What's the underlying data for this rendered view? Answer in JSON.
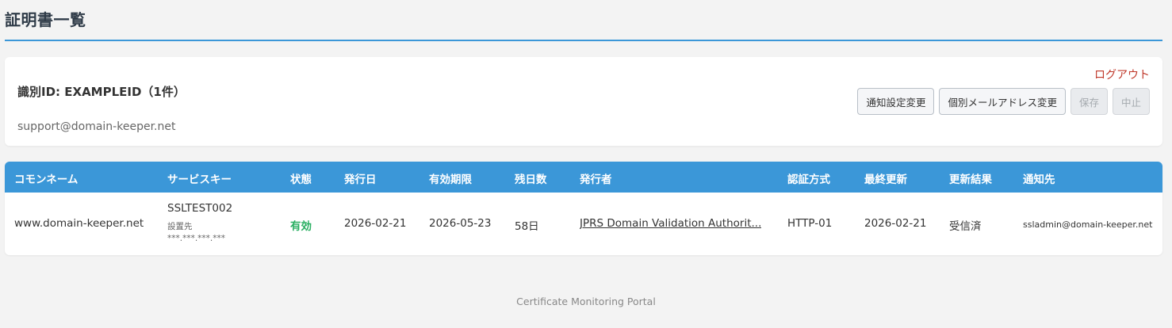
{
  "page": {
    "title": "証明書一覧"
  },
  "account": {
    "id_label": "識別ID: EXAMPLEID（1件）",
    "email": "support@domain-keeper.net"
  },
  "header_actions": {
    "logout": "ログアウト",
    "buttons": {
      "notify_settings": "通知設定変更",
      "mail_change": "個別メールアドレス変更",
      "save": "保存",
      "cancel": "中止"
    }
  },
  "table": {
    "columns": {
      "common_name": "コモンネーム",
      "service_key": "サービスキー",
      "status": "状態",
      "issued": "発行日",
      "expiry": "有効期限",
      "days_left": "残日数",
      "issuer": "発行者",
      "auth_method": "認証方式",
      "last_update": "最終更新",
      "update_result": "更新結果",
      "notify_to": "通知先"
    },
    "rows": [
      {
        "common_name": "www.domain-keeper.net",
        "service_key": "SSLTEST002",
        "install_label": "設置先",
        "install_ip": "***.***.***.***",
        "status": "有効",
        "issued": "2026-02-21",
        "expiry": "2026-05-23",
        "days_left": "58日",
        "issuer": "JPRS Domain Validation Authorit...",
        "auth_method": "HTTP-01",
        "last_update": "2026-02-21",
        "update_result": "受信済",
        "notify_to": "ssladmin@domain-keeper.net"
      }
    ]
  },
  "footer": {
    "text": "Certificate Monitoring Portal"
  },
  "colors": {
    "accent": "#3b97d8",
    "status_ok": "#27ae60",
    "logout": "#c0392b"
  }
}
